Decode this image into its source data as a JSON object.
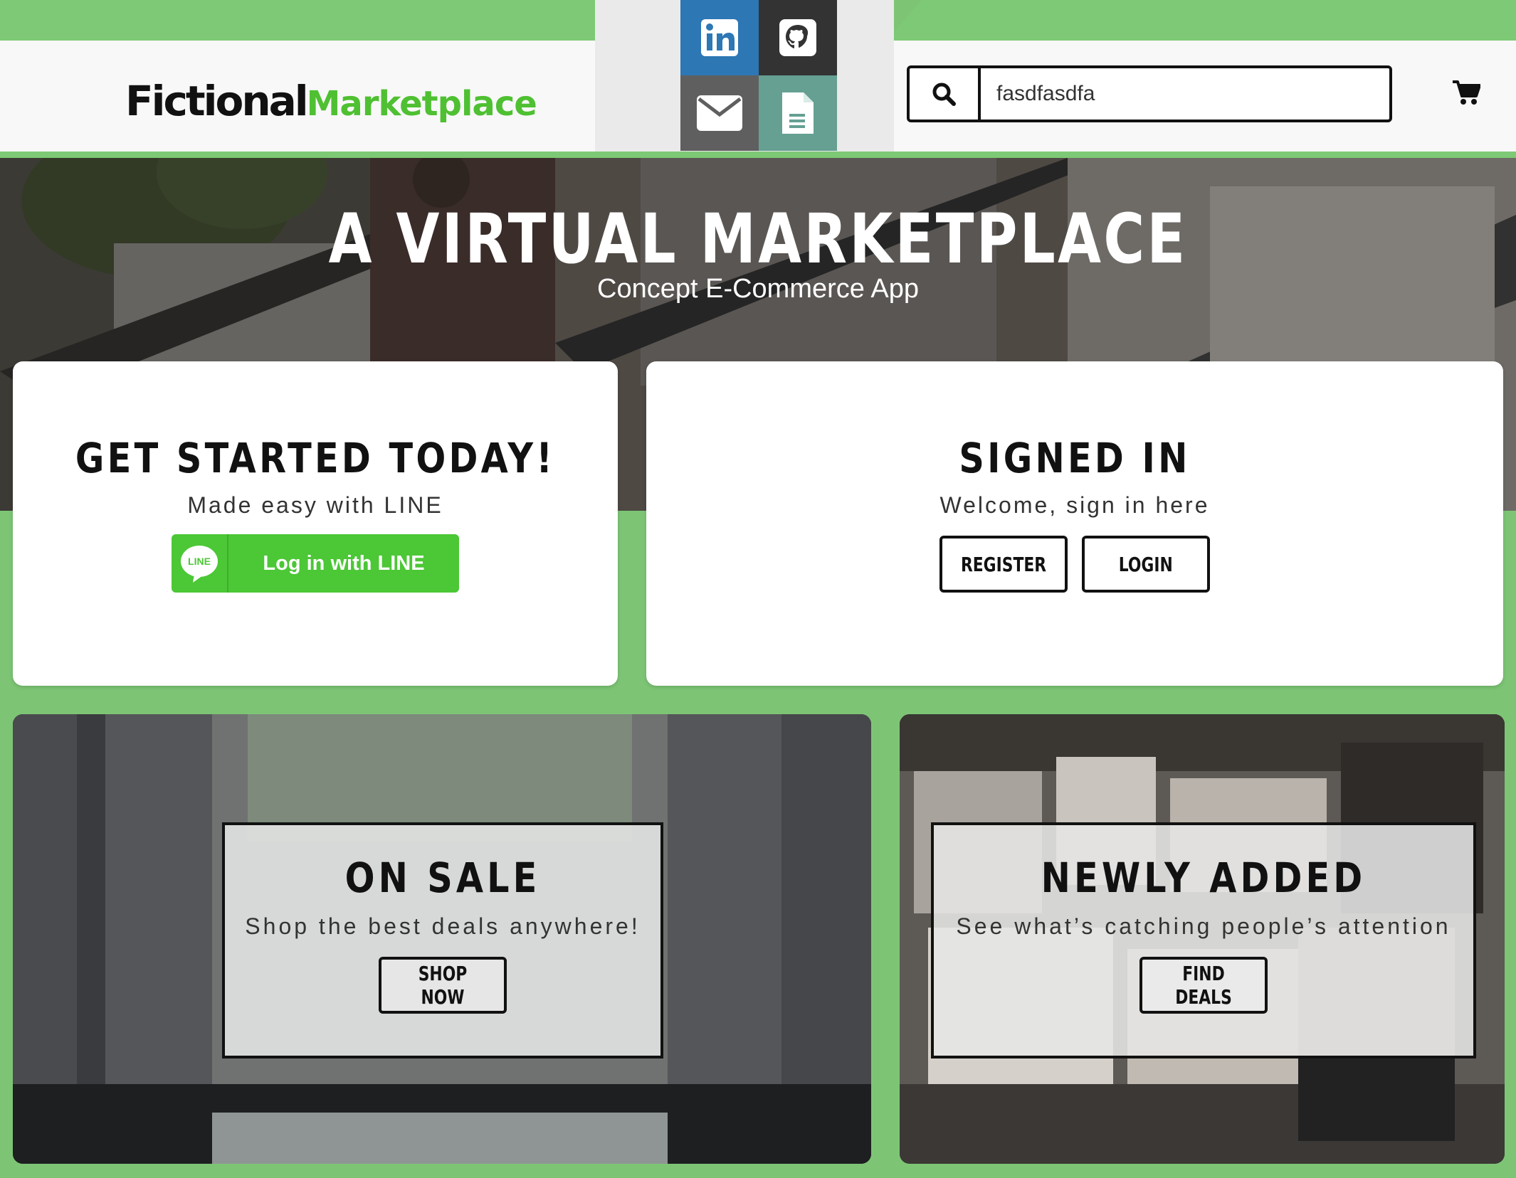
{
  "header": {
    "logo_part1": "Fictional",
    "logo_part2": "Marketplace",
    "social": [
      {
        "name": "linkedin-icon",
        "color": "#2d77b4"
      },
      {
        "name": "github-icon",
        "color": "#333333"
      },
      {
        "name": "mail-icon",
        "color": "#5f5f5f"
      },
      {
        "name": "document-icon",
        "color": "#65a093"
      }
    ],
    "search_value": "fasdfasdfa",
    "cart_icon": "cart-icon"
  },
  "hero": {
    "title": "A VIRTUAL MARKETPLACE",
    "subtitle": "Concept E-Commerce App"
  },
  "get_started": {
    "title": "GET STARTED TODAY!",
    "subtitle": "Made easy with LINE",
    "line_icon_text": "LINE",
    "line_button": "Log in with LINE"
  },
  "signed_in": {
    "title": "SIGNED IN",
    "subtitle": "Welcome, sign in here",
    "register_button": "REGISTER",
    "login_button": "LOGIN"
  },
  "promos": {
    "sale": {
      "title": "ON SALE",
      "subtitle": "Shop the best deals anywhere!",
      "button": "SHOP NOW"
    },
    "new": {
      "title": "NEWLY ADDED",
      "subtitle": "See what’s catching people’s attention",
      "button": "FIND DEALS"
    }
  },
  "colors": {
    "brand_green": "#7dc975",
    "line_green": "#4cc736",
    "logo_green": "#4fc032"
  }
}
